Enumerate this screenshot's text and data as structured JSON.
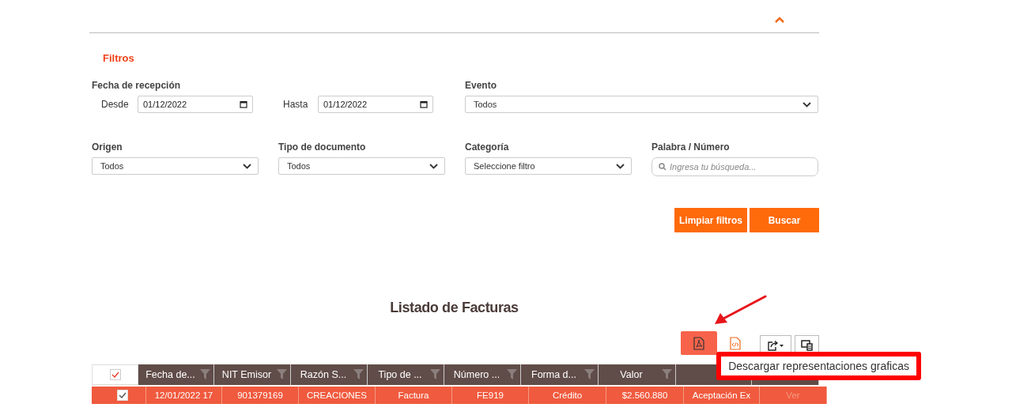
{
  "panel": {
    "expanded": true
  },
  "filters": {
    "title": "Filtros",
    "date": {
      "label": "Fecha de recepción",
      "from_label": "Desde",
      "from_value": "01/12/2022",
      "to_label": "Hasta",
      "to_value": "01/12/2022"
    },
    "event": {
      "label": "Evento",
      "value": "Todos"
    },
    "selects": [
      {
        "label": "Origen",
        "value": "Todos"
      },
      {
        "label": "Tipo de documento",
        "value": "Todos"
      },
      {
        "label": "Categoría",
        "value": "Seleccione filtro"
      }
    ],
    "search": {
      "label": "Palabra / Número",
      "placeholder": "Ingresa tu búsqueda..."
    },
    "buttons": [
      "Limpiar filtros",
      "Buscar"
    ]
  },
  "list": {
    "title": "Listado de Facturas",
    "toolbar": [
      {
        "kind": "pdf",
        "selected": true
      },
      {
        "kind": "xml",
        "selected": false
      },
      {
        "kind": "export",
        "selected": false
      },
      {
        "kind": "columns",
        "selected": false
      }
    ],
    "tooltip": "Descargar representaciones graficas",
    "table": {
      "all_checked": true,
      "columns": [
        {
          "kind": "filter",
          "label": "Fecha de..."
        },
        {
          "kind": "filter",
          "label": "NIT Emisor"
        },
        {
          "kind": "filter",
          "label": "Razón S..."
        },
        {
          "kind": "filter",
          "label": "Tipo de ..."
        },
        {
          "kind": "filter",
          "label": "Número ..."
        },
        {
          "kind": "filter",
          "label": "Forma d..."
        },
        {
          "kind": "filter",
          "label": "Valor"
        },
        {
          "kind": "blank"
        },
        {
          "kind": "blank"
        }
      ],
      "rows": [
        {
          "selected": true,
          "checked": true,
          "cells": [
            "12/01/2022 17",
            "901379169",
            "CREACIONES",
            "Factura",
            "FE919",
            "Crédito",
            "$2.560.880",
            "Aceptación Ex",
            "Ver"
          ]
        }
      ]
    }
  }
}
